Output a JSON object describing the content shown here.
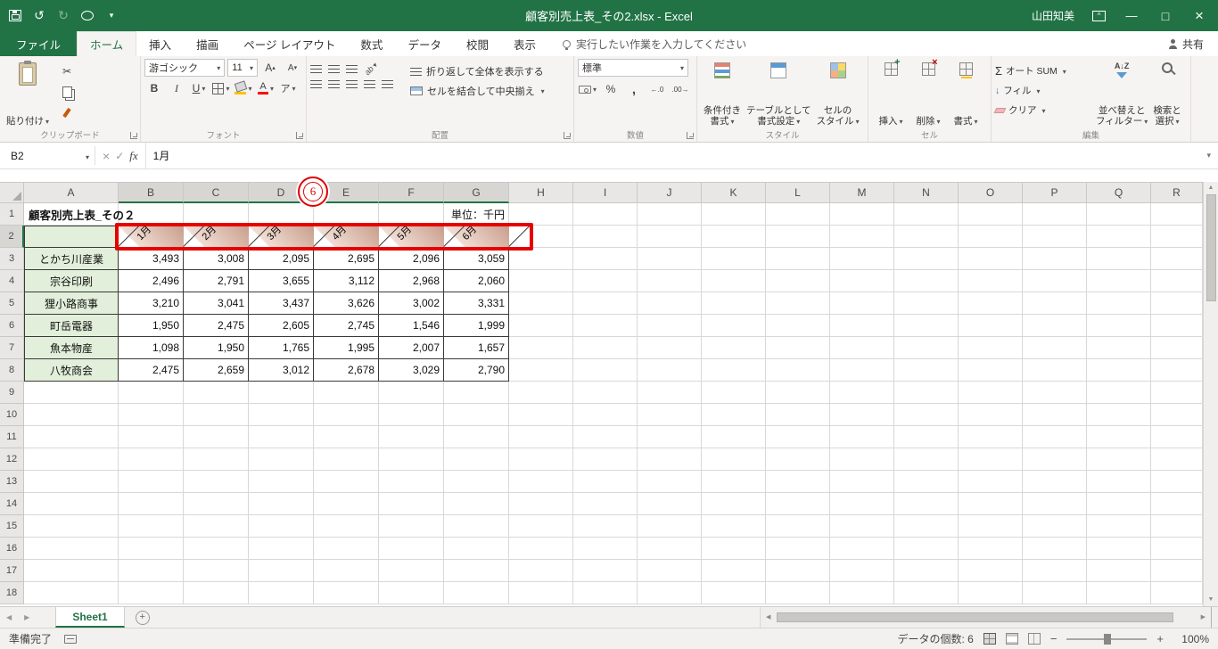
{
  "titlebar": {
    "title": "顧客別売上表_その2.xlsx - Excel",
    "user": "山田知美"
  },
  "tabs": {
    "items": [
      "ファイル",
      "ホーム",
      "挿入",
      "描画",
      "ページ レイアウト",
      "数式",
      "データ",
      "校閲",
      "表示"
    ],
    "active": "ホーム",
    "tellme": "実行したい作業を入力してください",
    "share": "共有"
  },
  "ribbon": {
    "paste": "貼り付け",
    "clipboard_label": "クリップボード",
    "font_name": "游ゴシック",
    "font_size": "11",
    "font_label": "フォント",
    "wrap_text": "折り返して全体を表示する",
    "merge_center": "セルを結合して中央揃え",
    "alignment_label": "配置",
    "number_format": "標準",
    "number_label": "数値",
    "conditional_1": "条件付き",
    "conditional_2": "書式",
    "table_1": "テーブルとして",
    "table_2": "書式設定",
    "cellstyles_1": "セルの",
    "cellstyles_2": "スタイル",
    "styles_label": "スタイル",
    "insert": "挿入",
    "delete": "削除",
    "format": "書式",
    "cells_label": "セル",
    "autosum": "オート SUM",
    "fill": "フィル",
    "clear": "クリア",
    "sort_1": "並べ替えと",
    "sort_2": "フィルター",
    "find_1": "検索と",
    "find_2": "選択",
    "editing_label": "編集"
  },
  "formula_bar": {
    "name_box": "B2",
    "fx": "fx",
    "content": "1月"
  },
  "grid": {
    "columns": [
      "A",
      "B",
      "C",
      "D",
      "E",
      "F",
      "G",
      "H",
      "I",
      "J",
      "K",
      "L",
      "M",
      "N",
      "O",
      "P",
      "Q",
      "R"
    ],
    "rows": [
      "1",
      "2",
      "3",
      "4",
      "5",
      "6",
      "7",
      "8",
      "9",
      "10",
      "11",
      "12",
      "13",
      "14",
      "15",
      "16",
      "17",
      "18"
    ],
    "selected_columns": [
      "B",
      "C",
      "D",
      "E",
      "F",
      "G"
    ],
    "selected_row": "2"
  },
  "sheet": {
    "title_cell": "顧客別売上表_その２",
    "unit_cell": "単位：千円",
    "months": [
      "1月",
      "2月",
      "3月",
      "4月",
      "5月",
      "6月"
    ],
    "companies": [
      {
        "name": "とかち川産業",
        "values": [
          "3,493",
          "3,008",
          "2,095",
          "2,695",
          "2,096",
          "3,059"
        ]
      },
      {
        "name": "宗谷印刷",
        "values": [
          "2,496",
          "2,791",
          "3,655",
          "3,112",
          "2,968",
          "2,060"
        ]
      },
      {
        "name": "狸小路商事",
        "values": [
          "3,210",
          "3,041",
          "3,437",
          "3,626",
          "3,002",
          "3,331"
        ]
      },
      {
        "name": "町岳電器",
        "values": [
          "1,950",
          "2,475",
          "2,605",
          "2,745",
          "1,546",
          "1,999"
        ]
      },
      {
        "name": "魚本物産",
        "values": [
          "1,098",
          "1,950",
          "1,765",
          "1,995",
          "2,007",
          "1,657"
        ]
      },
      {
        "name": "八牧商会",
        "values": [
          "2,475",
          "2,659",
          "3,012",
          "2,678",
          "3,029",
          "2,790"
        ]
      }
    ]
  },
  "annotation": {
    "number": "6"
  },
  "sheetbar": {
    "tab": "Sheet1"
  },
  "status": {
    "ready": "準備完了",
    "count": "データの個数: 6",
    "zoom": "100%"
  },
  "icons": {
    "save-icon": "floppy-disk",
    "undo-icon": "↺",
    "redo-icon": "↻",
    "touch-mode-icon": "circle-pointer",
    "ribbon-display-options-icon": "box-chevron",
    "minimize-icon": "—",
    "maximize-icon": "□",
    "close-icon": "×",
    "lightbulb-icon": "lightbulb",
    "share-icon": "person",
    "cut-icon": "✂",
    "copy-icon": "two-sheets",
    "format-painter-icon": "brush",
    "borders-icon": "grid-plus",
    "fill-color-icon": "bucket-yellow-bar",
    "font-color-icon": "A-red-bar",
    "phonetic-icon": "ア",
    "sigma-icon": "Σ",
    "fill-down-icon": "↓",
    "clear-icon": "eraser",
    "sort-filter-icon": "AZ-funnel",
    "find-select-icon": "magnifier",
    "caret-icon": "▾",
    "scroll-arrows": "▲▼◀▶"
  },
  "colors": {
    "excel_green": "#217346",
    "annotation_red": "#e60000",
    "fill_green": "#e2efda",
    "fill_rose": "#c99e8c"
  }
}
